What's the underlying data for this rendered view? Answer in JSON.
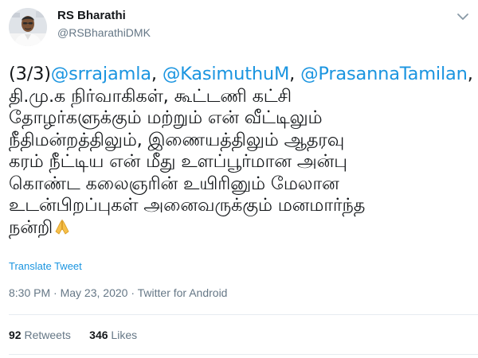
{
  "author": {
    "display_name": "RS Bharathi",
    "handle": "@RSBharathiDMK"
  },
  "tweet": {
    "prefix": "(3/3)",
    "mentions": [
      "@srrajamla",
      "@KasimuthuM",
      "@PrasannaTamilan"
    ],
    "separator": ", ",
    "trailing_comma": ",",
    "lines": [
      "தி.மு.க நிர்வாகிகள், கூட்டணி கட்சி",
      "தோழர்களுக்கும் மற்றும் என் வீட்டிலும்",
      "நீதிமன்றத்திலும், இணையத்திலும் ஆதரவு",
      "கரம் நீட்டிய என் மீது உளப்பூர்மான அன்பு",
      "கொண்ட கலைஞரின் உயிரினும் மேலான",
      "உடன்பிறப்புகள் அனைவருக்கும் மனமார்ந்த",
      "நன்றி"
    ],
    "emoji": "folded-hands-icon"
  },
  "translate_link": "Translate Tweet",
  "meta": {
    "time": "8:30 PM",
    "dot": " · ",
    "date": "May 23, 2020",
    "source": "Twitter for Android"
  },
  "stats": {
    "retweets_count": "92",
    "retweets_label": "Retweets",
    "likes_count": "346",
    "likes_label": "Likes"
  },
  "colors": {
    "link": "#1b95e0",
    "text": "#14171a",
    "muted": "#657786",
    "divider": "#e6ecf0"
  }
}
